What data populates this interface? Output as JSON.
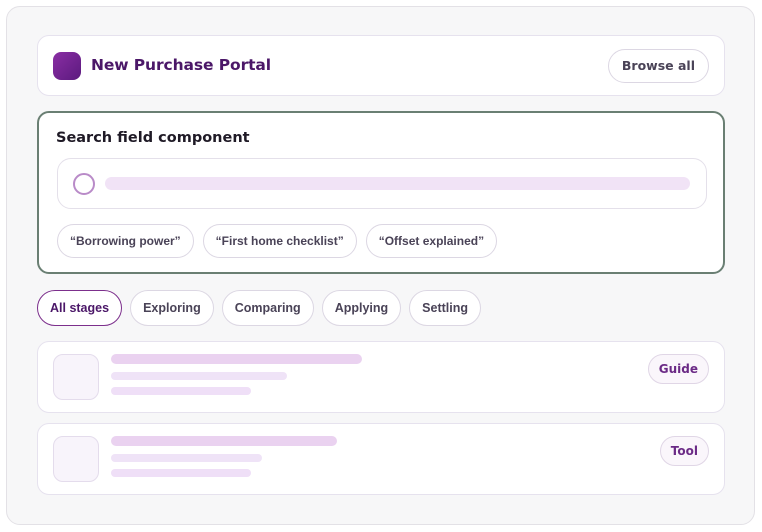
{
  "header": {
    "title": "New Purchase Portal",
    "browse_label": "Browse all",
    "logo_icon": "app-logo-icon"
  },
  "search": {
    "label": "Search field component",
    "placeholder": "",
    "icon": "search-icon",
    "suggestions": [
      "“Borrowing power”",
      "“First home checklist”",
      "“Offset explained”"
    ]
  },
  "filters": {
    "items": [
      "All stages",
      "Exploring",
      "Comparing",
      "Applying",
      "Settling"
    ],
    "selected": "All stages"
  },
  "results": [
    {
      "badge": "Guide"
    },
    {
      "badge": "Tool"
    }
  ],
  "colors": {
    "brand": "#5b1a7e",
    "accent": "#7c2f8c",
    "search_border": "#6a7f73"
  }
}
